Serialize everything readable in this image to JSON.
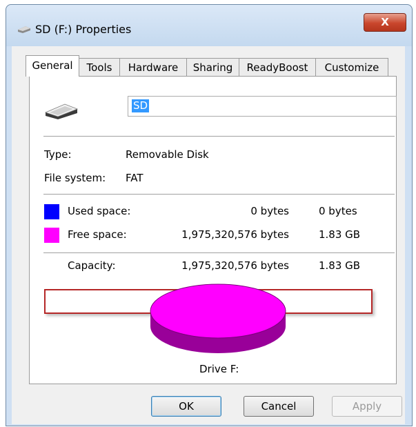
{
  "window": {
    "title": "SD (F:) Properties",
    "close_label": "X"
  },
  "tabs": [
    {
      "label": "General"
    },
    {
      "label": "Tools"
    },
    {
      "label": "Hardware"
    },
    {
      "label": "Sharing"
    },
    {
      "label": "ReadyBoost"
    },
    {
      "label": "Customize"
    }
  ],
  "general": {
    "drive_name": "SD",
    "type_label": "Type:",
    "type_value": "Removable Disk",
    "fs_label": "File system:",
    "fs_value": "FAT",
    "used": {
      "label": "Used space:",
      "bytes": "0 bytes",
      "size": "0 bytes",
      "color": "#0000ff"
    },
    "free": {
      "label": "Free space:",
      "bytes": "1,975,320,576 bytes",
      "size": "1.83 GB",
      "color": "#ff00ff"
    },
    "capacity": {
      "label": "Capacity:",
      "bytes": "1,975,320,576 bytes",
      "size": "1.83 GB"
    },
    "drive_caption": "Drive F:",
    "pie": {
      "free_fraction": 1.0,
      "free_color": "#ff00ff",
      "side_color": "#990099"
    }
  },
  "buttons": {
    "ok": "OK",
    "cancel": "Cancel",
    "apply": "Apply"
  }
}
